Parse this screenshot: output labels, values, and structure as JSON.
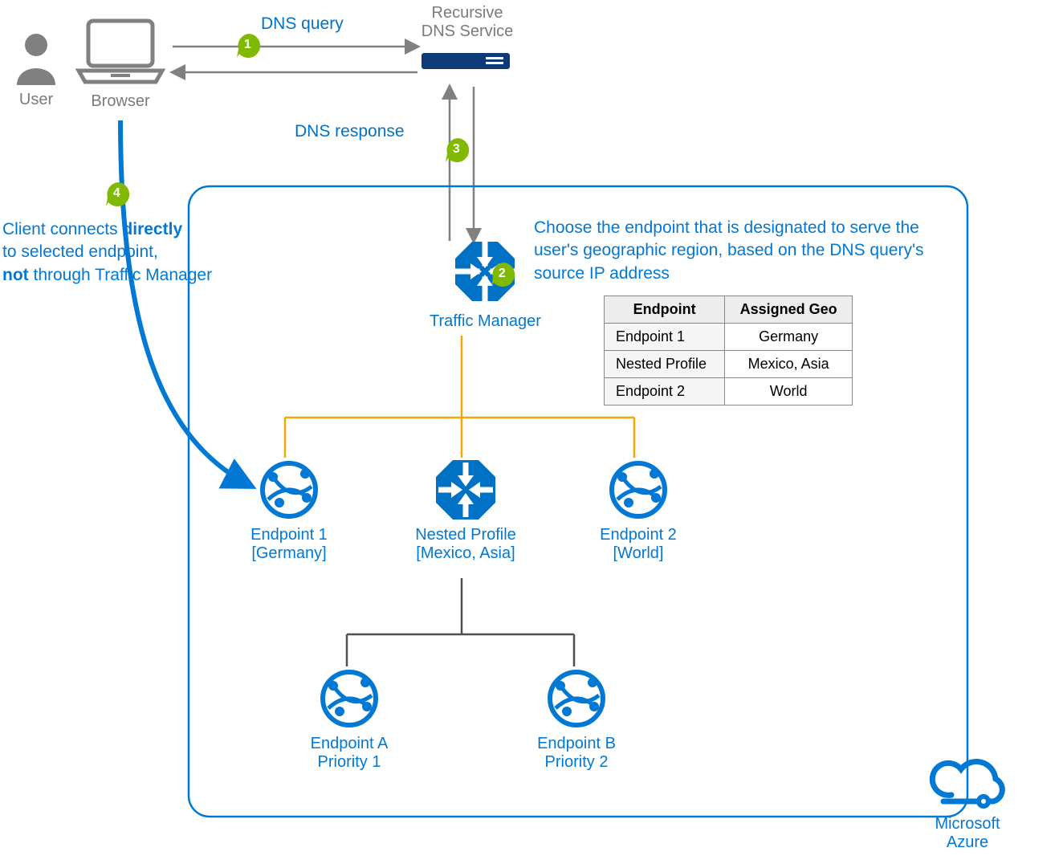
{
  "nodes": {
    "user": "User",
    "browser": "Browser",
    "dns_line1": "Recursive",
    "dns_line2": "DNS Service",
    "tm": "Traffic Manager",
    "ep1_name": "Endpoint 1",
    "ep1_geo": "[Germany]",
    "nested_name": "Nested Profile",
    "nested_geo": "[Mexico, Asia]",
    "ep2_name": "Endpoint 2",
    "ep2_geo": "[World]",
    "epA_name": "Endpoint A",
    "epA_prio": "Priority 1",
    "epB_name": "Endpoint B",
    "epB_prio": "Priority 2",
    "azure_l1": "Microsoft",
    "azure_l2": "Azure"
  },
  "steps": {
    "s1": "1",
    "s1_label": "DNS query",
    "s2": "2",
    "s2_desc": "Choose the endpoint that is designated to serve the user's geographic region, based on the DNS query's source IP address",
    "s3": "3",
    "s3_label": "DNS response",
    "s4": "4",
    "s4_l1a": "Client connects ",
    "s4_l1b": "directly",
    "s4_l2": "to selected endpoint,",
    "s4_l3a": "not",
    "s4_l3b": " through Traffic Manager"
  },
  "table": {
    "h1": "Endpoint",
    "h2": "Assigned Geo",
    "rows": [
      {
        "ep": "Endpoint 1",
        "geo": "Germany"
      },
      {
        "ep": "Nested Profile",
        "geo": "Mexico, Asia"
      },
      {
        "ep": "Endpoint 2",
        "geo": "World"
      }
    ]
  }
}
